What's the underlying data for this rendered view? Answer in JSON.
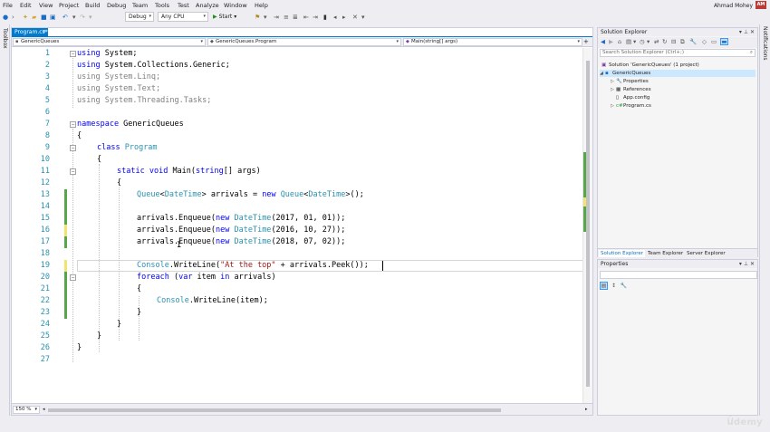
{
  "menu": [
    "File",
    "Edit",
    "View",
    "Project",
    "Build",
    "Debug",
    "Team",
    "Tools",
    "Test",
    "Analyze",
    "Window",
    "Help"
  ],
  "user": {
    "name": "Ahmad Mohey",
    "initials": "AM"
  },
  "toolbar": {
    "config": "Debug",
    "platform": "Any CPU",
    "start_label": "Start"
  },
  "toolbox_label": "Toolbox",
  "notifications_label": "Notifications",
  "editor": {
    "tab_label": "Program.cs*",
    "nav": {
      "project": "GenericQueues",
      "type": "GenericQueues.Program",
      "member": "Main(string[] args)"
    },
    "zoom": "150 %",
    "code": [
      {
        "n": "1"
      },
      {
        "n": "2"
      },
      {
        "n": "3"
      },
      {
        "n": "4"
      },
      {
        "n": "5"
      },
      {
        "n": "6"
      },
      {
        "n": "7"
      },
      {
        "n": "8"
      },
      {
        "n": "9"
      },
      {
        "n": "10"
      },
      {
        "n": "11"
      },
      {
        "n": "12"
      },
      {
        "n": "13"
      },
      {
        "n": "14"
      },
      {
        "n": "15"
      },
      {
        "n": "16"
      },
      {
        "n": "17"
      },
      {
        "n": "18"
      },
      {
        "n": "19"
      },
      {
        "n": "20"
      },
      {
        "n": "21"
      },
      {
        "n": "22"
      },
      {
        "n": "23"
      },
      {
        "n": "24"
      },
      {
        "n": "25"
      },
      {
        "n": "26"
      },
      {
        "n": "27"
      }
    ],
    "tokens": {
      "l1": [
        "using",
        " System;"
      ],
      "l2": [
        "using",
        " System.Collections.Generic;"
      ],
      "l3": "using System.Linq;",
      "l4": "using System.Text;",
      "l5": "using System.Threading.Tasks;",
      "l7": [
        "namespace",
        " GenericQueues"
      ],
      "l8": "{",
      "l9": [
        "class",
        " ",
        "Program"
      ],
      "l10": "{",
      "l11": [
        "static",
        " ",
        "void",
        " Main(",
        "string",
        "[] args)"
      ],
      "l12": "{",
      "l13": [
        "Queue",
        "<",
        "DateTime",
        "> arrivals = ",
        "new",
        " ",
        "Queue",
        "<",
        "DateTime",
        ">();"
      ],
      "l15": [
        "arrivals.Enqueue(",
        "new",
        " ",
        "DateTime",
        "(2017, 01, 01));"
      ],
      "l16": [
        "arrivals.Enqueue(",
        "new",
        " ",
        "DateTime",
        "(2016, 10, 27));"
      ],
      "l17": [
        "arrivals.Enqueue(",
        "new",
        " ",
        "DateTime",
        "(2018, 07, 02));"
      ],
      "l19": [
        "Console",
        ".WriteLine(",
        "\"At the top\"",
        " + arrivals.Peek());"
      ],
      "l20": [
        "foreach",
        " (",
        "var",
        " item ",
        "in",
        " arrivals)"
      ],
      "l21": "{",
      "l22": [
        "Console",
        ".WriteLine(item);"
      ],
      "l23": "}",
      "l24": "}",
      "l25": "}",
      "l26": "}"
    }
  },
  "solution_explorer": {
    "title": "Solution Explorer",
    "search_placeholder": "Search Solution Explorer (Ctrl+;)",
    "tree": [
      {
        "label": "Solution 'GenericQueues' (1 project)"
      },
      {
        "label": "GenericQueues"
      },
      {
        "label": "Properties"
      },
      {
        "label": "References"
      },
      {
        "label": "App.config"
      },
      {
        "label": "Program.cs"
      }
    ],
    "tabs": [
      "Solution Explorer",
      "Team Explorer",
      "Server Explorer"
    ]
  },
  "properties": {
    "title": "Properties"
  },
  "watermark": "udemy",
  "colors": {
    "accent": "#007acc",
    "keyword": "#0000ff",
    "type": "#2b91af",
    "string": "#a31515",
    "changed": "#57a64a",
    "unsaved": "#efe470"
  }
}
